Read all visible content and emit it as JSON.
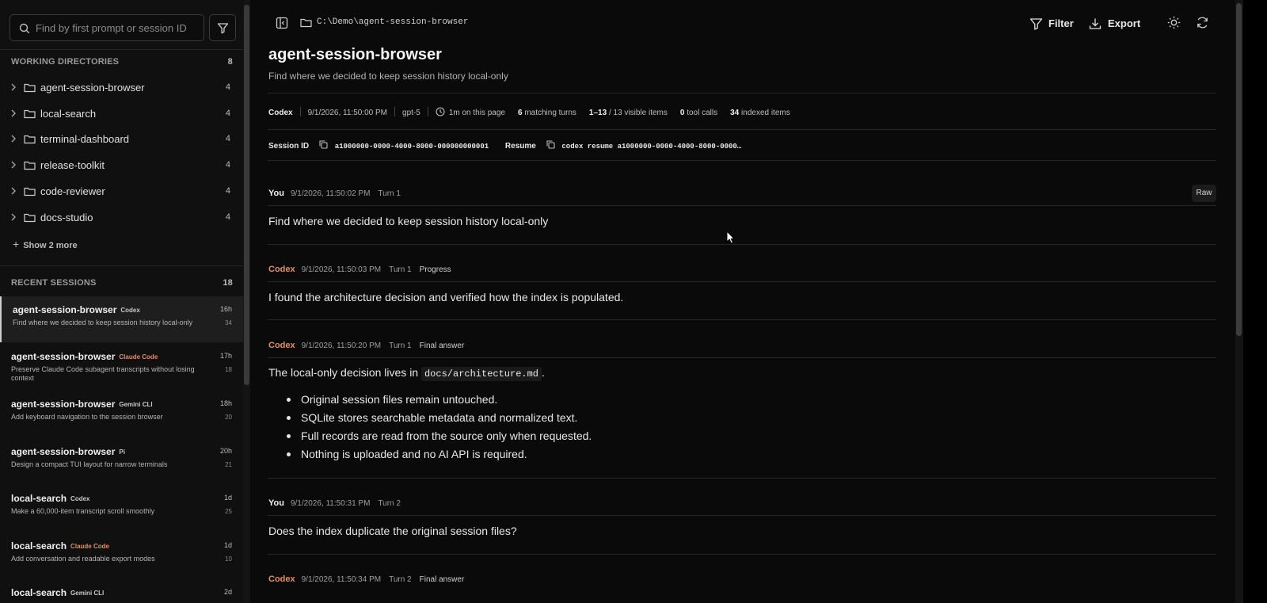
{
  "sidebar": {
    "search_placeholder": "Find by first prompt or session ID",
    "working_dirs_title": "WORKING DIRECTORIES",
    "working_dirs_count": "8",
    "dirs": [
      {
        "name": "agent-session-browser",
        "count": "4"
      },
      {
        "name": "local-search",
        "count": "4"
      },
      {
        "name": "terminal-dashboard",
        "count": "4"
      },
      {
        "name": "release-toolkit",
        "count": "4"
      },
      {
        "name": "code-reviewer",
        "count": "4"
      },
      {
        "name": "docs-studio",
        "count": "4"
      }
    ],
    "show_more": "Show 2 more",
    "recent_title": "RECENT SESSIONS",
    "recent_count": "18",
    "sessions": [
      {
        "title": "agent-session-browser",
        "tool": "Codex",
        "tool_color": "#c8c8c8",
        "desc": "Find where we decided to keep session history local-only",
        "age": "16h",
        "count": "34"
      },
      {
        "title": "agent-session-browser",
        "tool": "Claude Code",
        "tool_color": "#e0905e",
        "desc": "Preserve Claude Code subagent transcripts without losing context",
        "age": "17h",
        "count": "18"
      },
      {
        "title": "agent-session-browser",
        "tool": "Gemini CLI",
        "tool_color": "#c8c8c8",
        "desc": "Add keyboard navigation to the session browser",
        "age": "18h",
        "count": "20"
      },
      {
        "title": "agent-session-browser",
        "tool": "Pi",
        "tool_color": "#c8c8c8",
        "desc": "Design a compact TUI layout for narrow terminals",
        "age": "20h",
        "count": "21"
      },
      {
        "title": "local-search",
        "tool": "Codex",
        "tool_color": "#c8c8c8",
        "desc": "Make a 60,000-item transcript scroll smoothly",
        "age": "1d",
        "count": "25"
      },
      {
        "title": "local-search",
        "tool": "Claude Code",
        "tool_color": "#e0905e",
        "desc": "Add conversation and readable export modes",
        "age": "1d",
        "count": "10"
      },
      {
        "title": "local-search",
        "tool": "Gemini CLI",
        "tool_color": "#c8c8c8",
        "desc": "",
        "age": "2d",
        "count": ""
      }
    ]
  },
  "topbar": {
    "path": "C:\\Demo\\agent-session-browser",
    "filter_label": "Filter",
    "export_label": "Export"
  },
  "session": {
    "title": "agent-session-browser",
    "subtitle": "Find where we decided to keep session history local-only",
    "meta": {
      "agent": "Codex",
      "datetime": "9/1/2026, 11:50:00 PM",
      "model": "gpt-5",
      "time_on_page": "1m on this page",
      "matching_turns_num": "6",
      "matching_turns_label": "matching turns",
      "range": "1–13",
      "visible_items": "/ 13 visible items",
      "tool_calls_num": "0",
      "tool_calls_label": "tool calls",
      "indexed_num": "34",
      "indexed_label": "indexed items"
    },
    "session_id_label": "Session ID",
    "session_id": "a1000000-0000-4000-8000-000000000001",
    "resume_label": "Resume",
    "resume_cmd": "codex resume a1000000-0000-4000-8000-0000…"
  },
  "messages": {
    "m1": {
      "who": "You",
      "time": "9/1/2026, 11:50:02 PM",
      "turn": "Turn 1",
      "kind": "",
      "text": "Find where we decided to keep session history local-only",
      "raw_label": "Raw"
    },
    "m2": {
      "who": "Codex",
      "time": "9/1/2026, 11:50:03 PM",
      "turn": "Turn 1",
      "kind": "Progress",
      "text": "I found the architecture decision and verified how the index is populated."
    },
    "m3": {
      "who": "Codex",
      "time": "9/1/2026, 11:50:20 PM",
      "turn": "Turn 1",
      "kind": "Final answer",
      "text_pre": "The local-only decision lives in",
      "code": "docs/architecture.md",
      "text_post": ".",
      "bullets": [
        "Original session files remain untouched.",
        "SQLite stores searchable metadata and normalized text.",
        "Full records are read from the source only when requested.",
        "Nothing is uploaded and no AI API is required."
      ]
    },
    "m4": {
      "who": "You",
      "time": "9/1/2026, 11:50:31 PM",
      "turn": "Turn 2",
      "kind": "",
      "text": "Does the index duplicate the original session files?"
    },
    "m5": {
      "who": "Codex",
      "time": "9/1/2026, 11:50:34 PM",
      "turn": "Turn 2",
      "kind": "Final answer"
    }
  },
  "colors": {
    "accent_codex": "#e0905e",
    "background": "#0a0a0a",
    "sidebar_bg": "#101010"
  },
  "icons": [
    "search-icon",
    "filter-icon",
    "chevron-right-icon",
    "folder-icon",
    "plus-icon",
    "sidebar-toggle-icon",
    "export-icon",
    "sun-icon",
    "refresh-icon",
    "copy-icon",
    "mouse-cursor-icon"
  ]
}
